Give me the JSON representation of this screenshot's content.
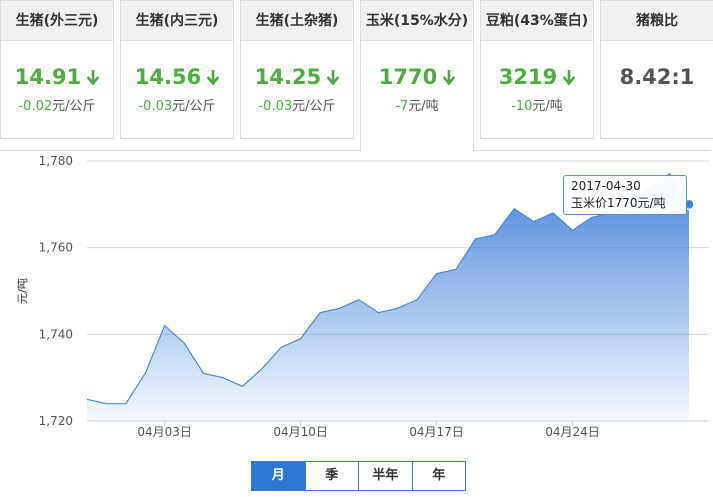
{
  "cards": [
    {
      "title": "生猪(外三元)",
      "price": "14.91",
      "change": "-0.02",
      "unit": "元/公斤",
      "trend": "down"
    },
    {
      "title": "生猪(内三元)",
      "price": "14.56",
      "change": "-0.03",
      "unit": "元/公斤",
      "trend": "down"
    },
    {
      "title": "生猪(土杂猪)",
      "price": "14.25",
      "change": "-0.03",
      "unit": "元/公斤",
      "trend": "down"
    },
    {
      "title": "玉米(15%水分)",
      "price": "1770",
      "change": "-7",
      "unit": "元/吨",
      "trend": "down"
    },
    {
      "title": "豆粕(43%蛋白)",
      "price": "3219",
      "change": "-10",
      "unit": "元/吨",
      "trend": "down"
    },
    {
      "title": "猪粮比",
      "price": "8.42:1",
      "change": "",
      "unit": "",
      "trend": "none"
    }
  ],
  "active_card_index": 3,
  "colors": {
    "down": "#4bae3f",
    "accent": "#2e78d2",
    "line": "#4a8ad6"
  },
  "chart_data": {
    "type": "area",
    "ylabel": "元/吨",
    "ylim": [
      1720,
      1780
    ],
    "yticks": [
      1720,
      1740,
      1760,
      1780
    ],
    "ytick_labels": [
      "1,720",
      "1,740",
      "1,760",
      "1,780"
    ],
    "x": [
      "2017-03-30",
      "2017-03-31",
      "2017-04-01",
      "2017-04-02",
      "2017-04-03",
      "2017-04-04",
      "2017-04-05",
      "2017-04-06",
      "2017-04-07",
      "2017-04-08",
      "2017-04-09",
      "2017-04-10",
      "2017-04-11",
      "2017-04-12",
      "2017-04-13",
      "2017-04-14",
      "2017-04-15",
      "2017-04-16",
      "2017-04-17",
      "2017-04-18",
      "2017-04-19",
      "2017-04-20",
      "2017-04-21",
      "2017-04-22",
      "2017-04-23",
      "2017-04-24",
      "2017-04-25",
      "2017-04-26",
      "2017-04-27",
      "2017-04-28",
      "2017-04-29",
      "2017-04-30"
    ],
    "values": [
      1725,
      1724,
      1724,
      1731,
      1742,
      1738,
      1731,
      1730,
      1728,
      1732,
      1737,
      1739,
      1745,
      1746,
      1748,
      1745,
      1746,
      1748,
      1754,
      1755,
      1762,
      1763,
      1769,
      1766,
      1768,
      1764,
      1767,
      1768,
      1771,
      1774,
      1777,
      1770
    ],
    "xtick_labels": [
      "04月03日",
      "04月10日",
      "04月17日",
      "04月24日"
    ],
    "xtick_dates": [
      "2017-04-03",
      "2017-04-10",
      "2017-04-17",
      "2017-04-24"
    ],
    "grid": true,
    "tooltip": {
      "date": "2017-04-30",
      "text": "玉米价1770元/吨"
    }
  },
  "periods": [
    "月",
    "季",
    "半年",
    "年"
  ],
  "active_period": 0
}
